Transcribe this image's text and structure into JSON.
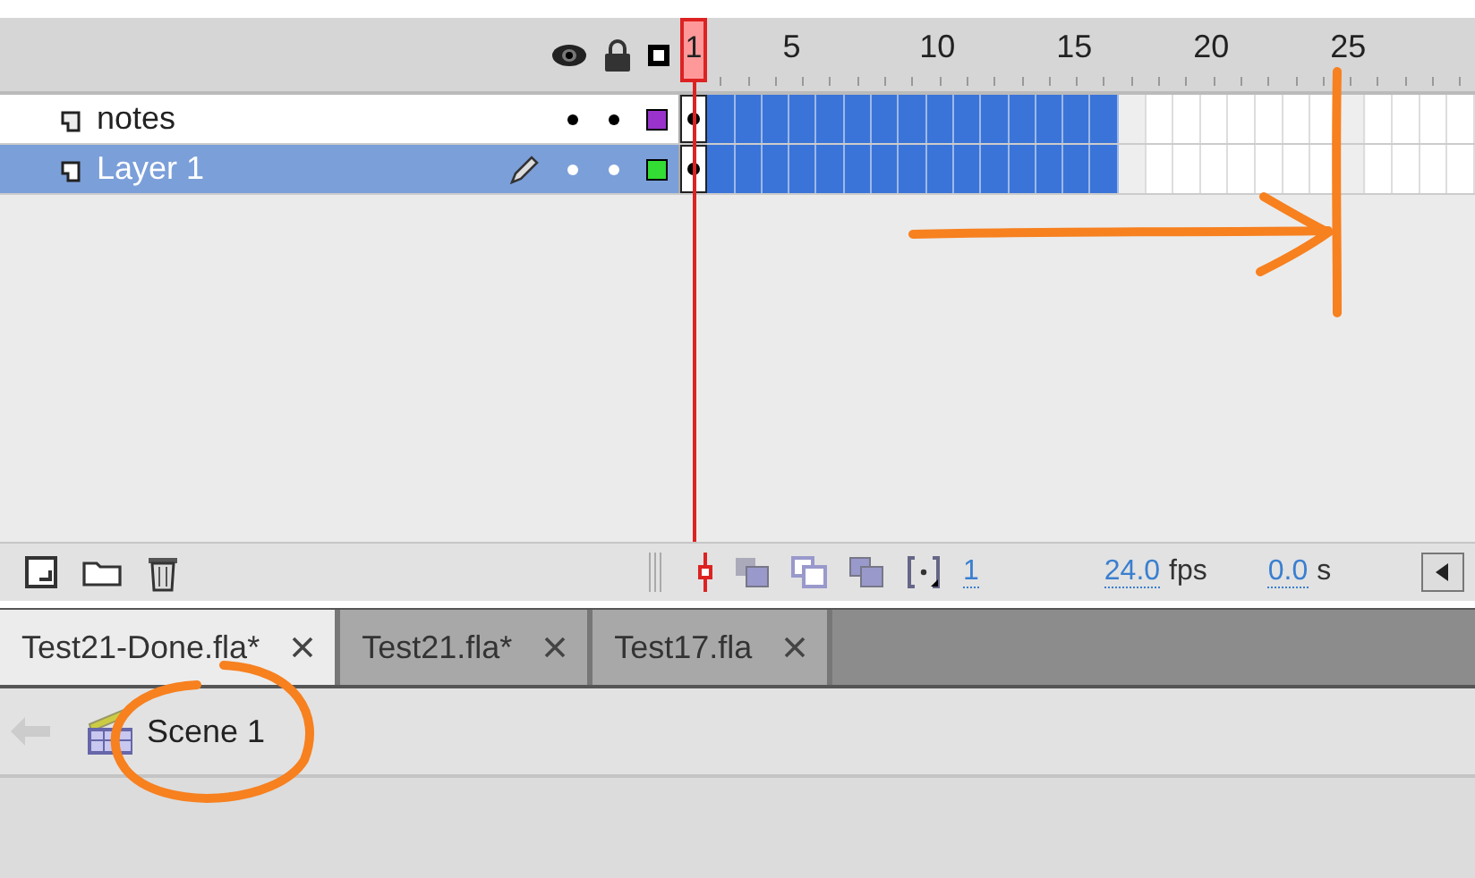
{
  "ruler": {
    "labels": [
      {
        "text": "1",
        "selected": true
      },
      {
        "text": "5",
        "selected": false
      },
      {
        "text": "10",
        "selected": false
      },
      {
        "text": "15",
        "selected": false
      },
      {
        "text": "20",
        "selected": false
      },
      {
        "text": "25",
        "selected": false
      }
    ]
  },
  "layers": [
    {
      "name": "notes",
      "selected": false,
      "editing": false,
      "color": "#9933cc",
      "level": 0.5517
    },
    {
      "name": "Layer 1",
      "selected": true,
      "editing": true,
      "color": "#33dd33",
      "level": 0.5517
    }
  ],
  "toolbar": {
    "current_frame": "1",
    "frame_rate": "24.0",
    "frame_rate_unit": "fps",
    "elapsed": "0.0",
    "elapsed_unit": "s"
  },
  "tabs": [
    {
      "label": "Test21-Done.fla*",
      "selected": true
    },
    {
      "label": "Test21.fla*",
      "selected": false
    },
    {
      "label": "Test17.fla",
      "selected": false
    }
  ],
  "breadcrumb": {
    "scene": "Scene 1"
  }
}
